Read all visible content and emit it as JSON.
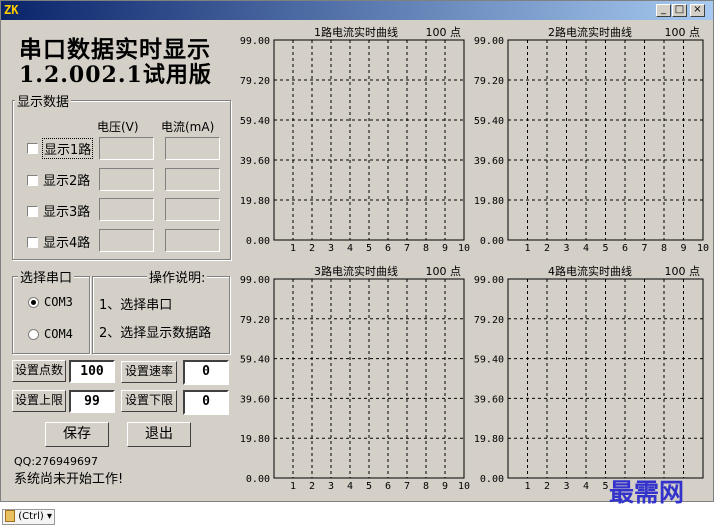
{
  "window": {
    "icon_text": "ZK",
    "buttons": {
      "minimize": "_",
      "maximize": "□",
      "close": "×"
    }
  },
  "app": {
    "title_line1": "串口数据实时显示",
    "title_line2": "1.2.002.1试用版"
  },
  "display_group": {
    "legend": "显示数据",
    "col_voltage": "电压(V)",
    "col_current": "电流(mA)",
    "channels": [
      {
        "label": "显示1路",
        "checked": false
      },
      {
        "label": "显示2路",
        "checked": false
      },
      {
        "label": "显示3路",
        "checked": false
      },
      {
        "label": "显示4路",
        "checked": false
      }
    ]
  },
  "port_group": {
    "legend": "选择串口",
    "options": [
      {
        "label": "COM3",
        "selected": true
      },
      {
        "label": "COM4",
        "selected": false
      }
    ]
  },
  "help_group": {
    "legend": "操作说明:",
    "steps": [
      "1、选择串口",
      "2、选择显示数据路"
    ]
  },
  "settings": {
    "points_label": "设置点数",
    "points_value": "100",
    "rate_label": "设置速率",
    "rate_value": "0",
    "upper_label": "设置上限",
    "upper_value": "99",
    "lower_label": "设置下限",
    "lower_value": "0"
  },
  "actions": {
    "save": "保存",
    "exit": "退出"
  },
  "status": {
    "qq": "QQ:276949697",
    "message": "系统尚未开始工作!"
  },
  "watermark": "最需网",
  "taskbar": {
    "ctrl_label": "(Ctrl)"
  },
  "chart_data": [
    {
      "type": "line",
      "title": "1路电流实时曲线",
      "points_label": "100 点",
      "ylim": [
        0,
        99
      ],
      "y_ticks": [
        "99.00",
        "79.20",
        "59.40",
        "39.60",
        "19.80",
        "0.00"
      ],
      "x_ticks": [
        "1",
        "2",
        "3",
        "4",
        "5",
        "6",
        "7",
        "8",
        "9",
        "10"
      ],
      "series": [],
      "grid": true
    },
    {
      "type": "line",
      "title": "2路电流实时曲线",
      "points_label": "100 点",
      "ylim": [
        0,
        99
      ],
      "y_ticks": [
        "99.00",
        "79.20",
        "59.40",
        "39.60",
        "19.80",
        "0.00"
      ],
      "x_ticks": [
        "1",
        "2",
        "3",
        "4",
        "5",
        "6",
        "7",
        "8",
        "9",
        "10"
      ],
      "series": [],
      "grid": true
    },
    {
      "type": "line",
      "title": "3路电流实时曲线",
      "points_label": "100 点",
      "ylim": [
        0,
        99
      ],
      "y_ticks": [
        "99.00",
        "79.20",
        "59.40",
        "39.60",
        "19.80",
        "0.00"
      ],
      "x_ticks": [
        "1",
        "2",
        "3",
        "4",
        "5",
        "6",
        "7",
        "8",
        "9",
        "10"
      ],
      "series": [],
      "grid": true
    },
    {
      "type": "line",
      "title": "4路电流实时曲线",
      "points_label": "100 点",
      "ylim": [
        0,
        99
      ],
      "y_ticks": [
        "99.00",
        "79.20",
        "59.40",
        "39.60",
        "19.80",
        "0.00"
      ],
      "x_ticks": [
        "1",
        "2",
        "3",
        "4",
        "5"
      ],
      "series": [],
      "grid": true
    }
  ]
}
